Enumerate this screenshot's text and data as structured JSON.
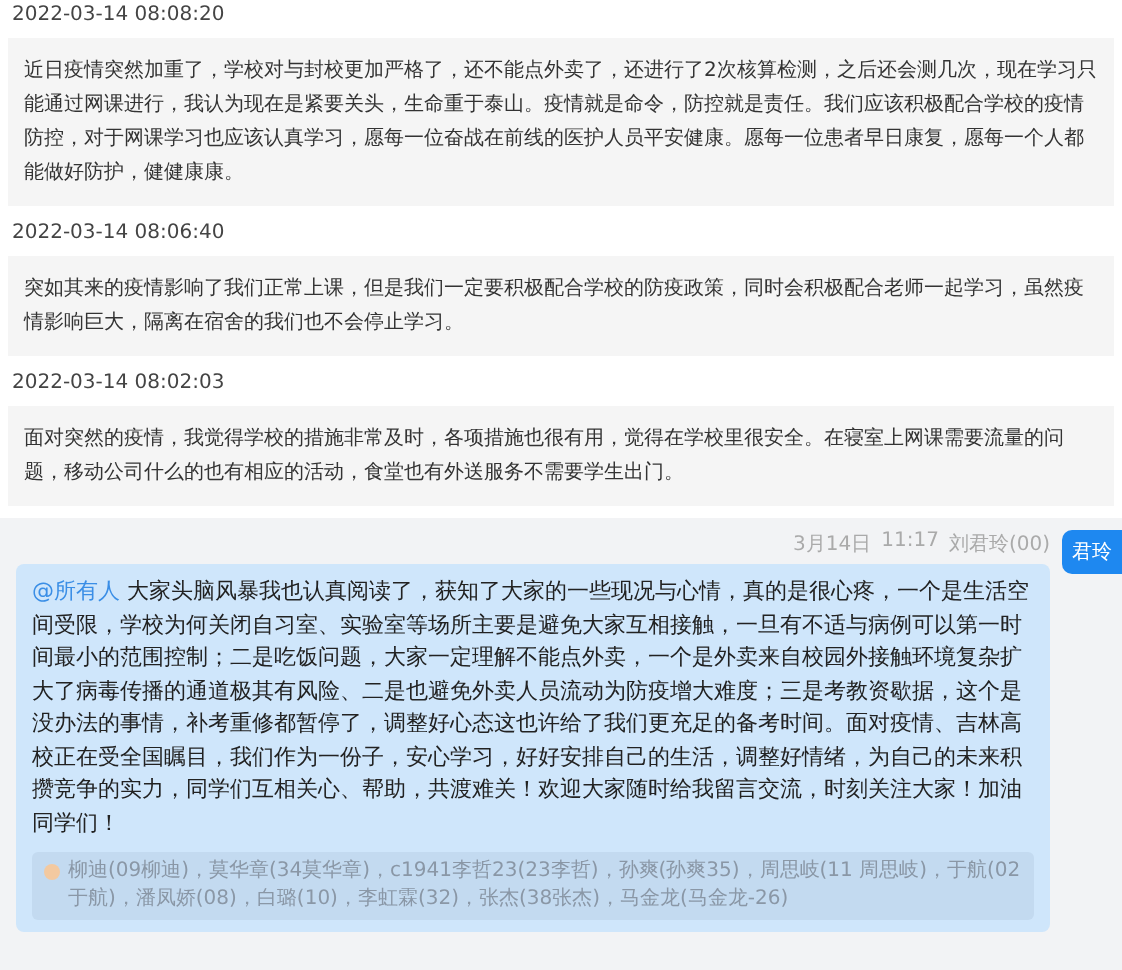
{
  "posts": [
    {
      "timestamp": "2022-03-14 08:08:20",
      "text": "近日疫情突然加重了，学校对与封校更加严格了，还不能点外卖了，还进行了2次核算检测，之后还会测几次，现在学习只能通过网课进行，我认为现在是紧要关头，生命重于泰山。疫情就是命令，防控就是责任。我们应该积极配合学校的疫情防控，对于网课学习也应该认真学习，愿每一位奋战在前线的医护人员平安健康。愿每一位患者早日康复，愿每一个人都能做好防护，健健康康。"
    },
    {
      "timestamp": "2022-03-14 08:06:40",
      "text": "突如其来的疫情影响了我们正常上课，但是我们一定要积极配合学校的防疫政策，同时会积极配合老师一起学习，虽然疫情影响巨大，隔离在宿舍的我们也不会停止学习。"
    },
    {
      "timestamp": "2022-03-14 08:02:03",
      "text": "面对突然的疫情，我觉得学校的措施非常及时，各项措施也很有用，觉得在学校里很安全。在寝室上网课需要流量的问题，移动公司什么的也有相应的活动，食堂也有外送服务不需要学生出门。"
    }
  ],
  "chat": {
    "date": "3月14日",
    "time": "11:17",
    "sender": "刘君玲(00)",
    "avatar_label": "君玲",
    "mention": "@所有人",
    "message": "大家头脑风暴我也认真阅读了，获知了大家的一些现况与心情，真的是很心疼，一个是生活空间受限，学校为何关闭自习室、实验室等场所主要是避免大家互相接触，一旦有不适与病例可以第一时间最小的范围控制；二是吃饭问题，大家一定理解不能点外卖，一个是外卖来自校园外接触环境复杂扩大了病毒传播的通道极其有风险、二是也避免外卖人员流动为防疫增大难度；三是考教资歇据，这个是没办法的事情，补考重修都暂停了，调整好心态这也许给了我们更充足的备考时间。面对疫情、吉林高校正在受全国瞩目，我们作为一份子，安心学习，好好安排自己的生活，调整好情绪，为自己的未来积攒竞争的实力，同学们互相关心、帮助，共渡难关！欢迎大家随时给我留言交流，时刻关注大家！加油同学们！",
    "read_by": "柳迪(09柳迪)，莫华章(34莫华章)，c1941李哲23(23李哲)，孙爽(孙爽35)，周思岐(11 周思岐)，于航(02于航)，潘凤娇(08)，白璐(10)，李虹霖(32)，张杰(38张杰)，马金龙(马金龙-26)"
  }
}
